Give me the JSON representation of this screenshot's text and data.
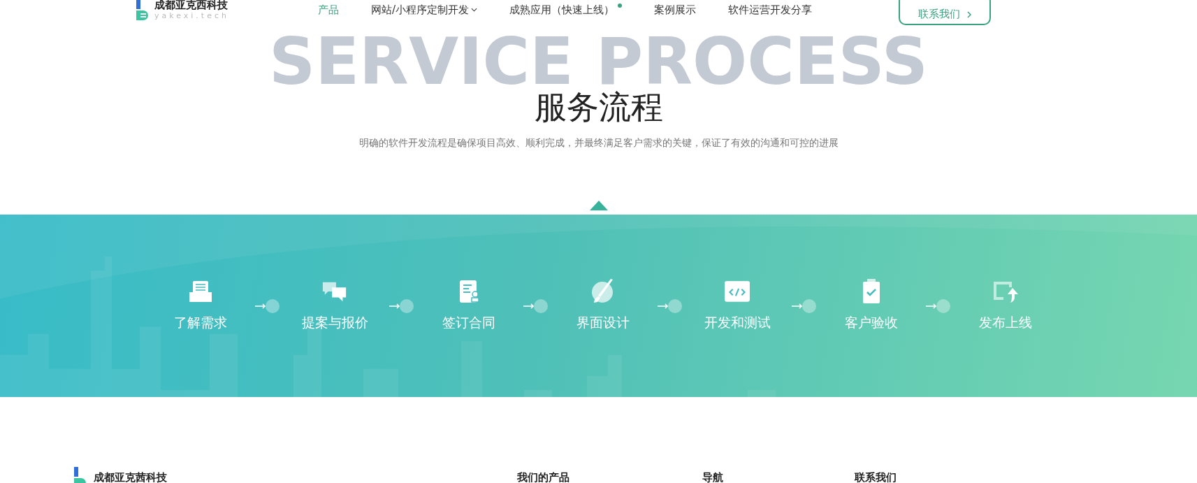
{
  "header": {
    "logo_name": "成都亚克西科技",
    "logo_domain": "yakexi.tech",
    "nav": [
      {
        "label": "产品",
        "selected": true,
        "dropdown": false,
        "dot": false
      },
      {
        "label": "网站/小程序定制开发",
        "selected": false,
        "dropdown": true,
        "dot": false
      },
      {
        "label": "成熟应用（快速上线）",
        "selected": false,
        "dropdown": false,
        "dot": true
      },
      {
        "label": "案例展示",
        "selected": false,
        "dropdown": false,
        "dot": false
      },
      {
        "label": "软件运营开发分享",
        "selected": false,
        "dropdown": false,
        "dot": false
      }
    ],
    "contact_button": "联系我们"
  },
  "section": {
    "watermark": "SERVICE PROCESS",
    "title": "服务流程",
    "subtitle": "明确的软件开发流程是确保项目高效、顺利完成，并最终满足客户需求的关键，保证了有效的沟通和可控的进展"
  },
  "steps": [
    {
      "kind": "inbox",
      "label": "了解需求"
    },
    {
      "kind": "chat",
      "label": "提案与报价"
    },
    {
      "kind": "contract",
      "label": "签订合同"
    },
    {
      "kind": "brush",
      "label": "界面设计"
    },
    {
      "kind": "code",
      "label": "开发和测试"
    },
    {
      "kind": "clipboard",
      "label": "客户验收"
    },
    {
      "kind": "launch",
      "label": "发布上线"
    }
  ],
  "footer": {
    "company": "成都亚克茜科技",
    "columns": [
      "我们的产品",
      "导航",
      "联系我们"
    ]
  }
}
